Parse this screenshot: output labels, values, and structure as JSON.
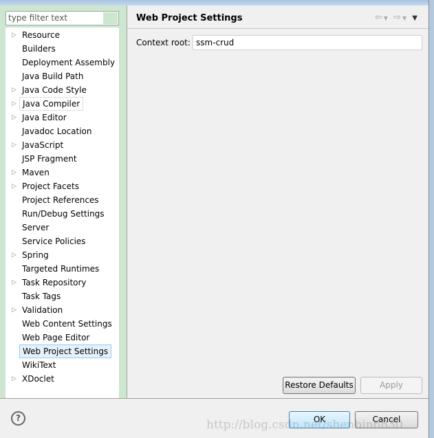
{
  "filter": {
    "placeholder": "type filter text"
  },
  "tree": [
    {
      "label": "Resource",
      "expandable": true
    },
    {
      "label": "Builders",
      "expandable": false
    },
    {
      "label": "Deployment Assembly",
      "expandable": false
    },
    {
      "label": "Java Build Path",
      "expandable": false
    },
    {
      "label": "Java Code Style",
      "expandable": true
    },
    {
      "label": "Java Compiler",
      "expandable": true,
      "focused": true
    },
    {
      "label": "Java Editor",
      "expandable": true
    },
    {
      "label": "Javadoc Location",
      "expandable": false
    },
    {
      "label": "JavaScript",
      "expandable": true
    },
    {
      "label": "JSP Fragment",
      "expandable": false
    },
    {
      "label": "Maven",
      "expandable": true
    },
    {
      "label": "Project Facets",
      "expandable": true
    },
    {
      "label": "Project References",
      "expandable": false
    },
    {
      "label": "Run/Debug Settings",
      "expandable": false
    },
    {
      "label": "Server",
      "expandable": false
    },
    {
      "label": "Service Policies",
      "expandable": false
    },
    {
      "label": "Spring",
      "expandable": true
    },
    {
      "label": "Targeted Runtimes",
      "expandable": false
    },
    {
      "label": "Task Repository",
      "expandable": true
    },
    {
      "label": "Task Tags",
      "expandable": false
    },
    {
      "label": "Validation",
      "expandable": true
    },
    {
      "label": "Web Content Settings",
      "expandable": false
    },
    {
      "label": "Web Page Editor",
      "expandable": false
    },
    {
      "label": "Web Project Settings",
      "expandable": false,
      "selected": true
    },
    {
      "label": "WikiText",
      "expandable": false
    },
    {
      "label": "XDoclet",
      "expandable": true
    }
  ],
  "page": {
    "title": "Web Project Settings",
    "context_root_label": "Context root:",
    "context_root_value": "ssm-crud"
  },
  "buttons": {
    "restore": "Restore Defaults",
    "apply": "Apply",
    "ok": "OK",
    "cancel": "Cancel",
    "help": "?"
  },
  "watermark": "http://blog.csdn.net/shenbin6830"
}
